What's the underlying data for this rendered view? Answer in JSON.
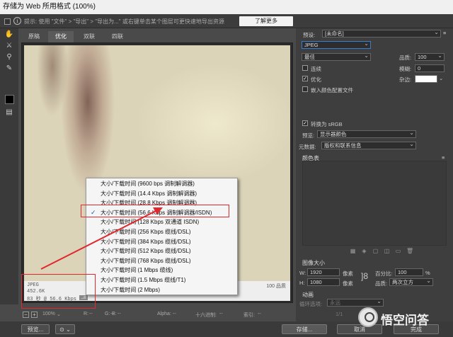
{
  "window": {
    "title": "存储为 Web 所用格式 (100%)"
  },
  "hint": {
    "text": "提示: 使用 \"文件\" > \"导出\" > \"导出为...\" 或右键单击某个图层可更快速地导出资源",
    "learn_more": "了解更多"
  },
  "tabs": [
    "原稿",
    "优化",
    "双联",
    "四联"
  ],
  "preview": {
    "info_format": "JPEG",
    "info_size": "452.6K",
    "info_time": "83 秒 @ 56.6 Kbps",
    "menu_icon": "→≡",
    "quality_label": "100 品质"
  },
  "download_menu": {
    "items": [
      "大小/下载时间 (9600 bps 调制解调器)",
      "大小/下载时间 (14.4 Kbps 调制解调器)",
      "大小/下载时间 (28.8 Kbps 调制解调器)",
      "大小/下载时间 (56.6 Kbps 调制解调器/ISDN)",
      "大小/下载时间 (128 Kbps 双通道 ISDN)",
      "大小/下载时间 (256 Kbps 缆线/DSL)",
      "大小/下载时间 (384 Kbps 缆线/DSL)",
      "大小/下载时间 (512 Kbps 缆线/DSL)",
      "大小/下载时间 (768 Kbps 缆线/DSL)",
      "大小/下载时间 (1 Mbps 缆线)",
      "大小/下载时间 (1.5 Mbps 缆线/T1)",
      "大小/下载时间 (2 Mbps)"
    ],
    "selected_index": 3,
    "check": "✓"
  },
  "status": {
    "zoom": "100%",
    "r": "R:",
    "g": "G:",
    "b": "B:",
    "alpha": "Alpha:",
    "hex": "十六进制:",
    "index": "索引:",
    "dashes": "--"
  },
  "bottom": {
    "preview": "预览...",
    "save": "存储...",
    "cancel": "取消",
    "done": "完成"
  },
  "panel": {
    "preset_label": "预设:",
    "preset_value": "[未命名]",
    "format": "JPEG",
    "quality_mode": "最佳",
    "quality_label": "品质:",
    "quality_value": "100",
    "progressive": "连续",
    "optimized": "优化",
    "embed_profile": "嵌入颜色配置文件",
    "blur_label": "模糊:",
    "blur_value": "0",
    "matte_label": "杂边:",
    "convert_srgb": "转换为 sRGB",
    "preview_label": "预览:",
    "preview_value": "显示器颜色",
    "metadata_label": "元数据:",
    "metadata_value": "版权和联系信息",
    "color_table": "颜色表",
    "image_size": "图像大小",
    "w_label": "W:",
    "w_value": "1920",
    "h_label": "H:",
    "h_value": "1080",
    "px": "像素",
    "percent_label": "百分比:",
    "percent_value": "100",
    "percent_unit": "%",
    "quality2_label": "品质:",
    "quality2_value": "两次立方",
    "animation": "动画",
    "loop_label": "循环选项:",
    "loop_value": "永远",
    "frame": "1/1"
  },
  "watermark": {
    "text": "悟空问答"
  },
  "colors": {
    "accent": "#3b7bd6",
    "annotation_red": "#e0282e",
    "check": "#0a5fb4"
  }
}
